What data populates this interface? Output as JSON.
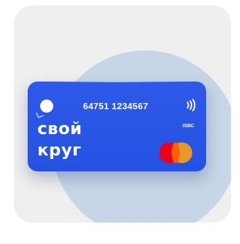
{
  "card": {
    "number": "64751 1234567",
    "brand_line_1": "свой",
    "brand_line_2": "круг",
    "bank_label": "ISBC",
    "payment_network_icon": "mastercard-logo",
    "contactless_icon": "contactless-icon"
  },
  "colors": {
    "frame_background": "#efefef",
    "circle": "#c7d6e6",
    "card_blue": "#2452e2",
    "text": "#ffffff",
    "mc_red": "#eb001b",
    "mc_yellow": "#f79e1b"
  }
}
